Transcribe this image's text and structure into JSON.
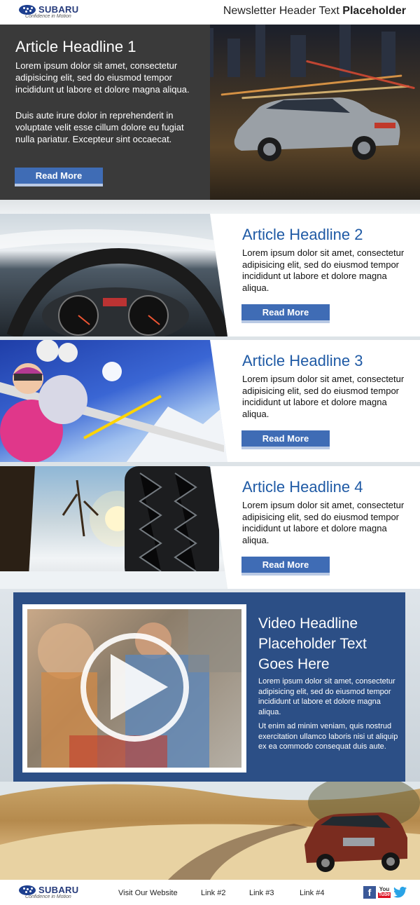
{
  "header": {
    "brand": "SUBARU",
    "tagline": "Confidence in Motion",
    "title_regular": "Newsletter Header Text ",
    "title_bold": "Placeholder"
  },
  "hero": {
    "headline": "Article Headline 1",
    "paragraph1": "Lorem ipsum dolor sit amet, consectetur adipisicing elit, sed do eiusmod tempor incididunt ut labore et dolore magna aliqua.",
    "paragraph2": "Duis aute irure dolor in reprehenderit in voluptate velit esse cillum dolore eu fugiat nulla pariatur. Excepteur sint occaecat.",
    "button": "Read More"
  },
  "articles": [
    {
      "headline": "Article Headline 2",
      "body": "Lorem ipsum dolor sit amet, consectetur adipisicing elit, sed do eiusmod tempor incididunt ut labore et dolore magna aliqua.",
      "button": "Read More"
    },
    {
      "headline": "Article Headline 3",
      "body": "Lorem ipsum dolor sit amet, consectetur adipisicing elit, sed do eiusmod tempor incididunt ut labore et dolore magna aliqua.",
      "button": "Read More"
    },
    {
      "headline": "Article Headline 4",
      "body": "Lorem ipsum dolor sit amet, consectetur adipisicing elit, sed do eiusmod tempor incididunt ut labore et dolore magna aliqua.",
      "button": "Read More"
    }
  ],
  "video": {
    "headline": "Video Headline Placeholder Text Goes Here",
    "paragraph1": "Lorem ipsum dolor sit amet, consectetur adipisicing elit, sed do eiusmod tempor incididunt ut labore et dolore magna aliqua.",
    "paragraph2": "Ut enim ad minim veniam, quis nostrud exercitation ullamco laboris nisi ut aliquip ex ea commodo consequat duis aute."
  },
  "footer": {
    "brand": "SUBARU",
    "tagline": "Confidence in Motion",
    "links": [
      "Visit Our Website",
      "Link #2",
      "Link #3",
      "Link #4"
    ],
    "social": {
      "facebook": "f",
      "youtube_top": "You",
      "youtube_bottom": "Tube"
    }
  },
  "colors": {
    "brand_blue": "#1f5aa5",
    "button_blue": "#3f6cb5",
    "video_panel": "#2c4f86",
    "hero_panel": "#3a3a3a"
  }
}
